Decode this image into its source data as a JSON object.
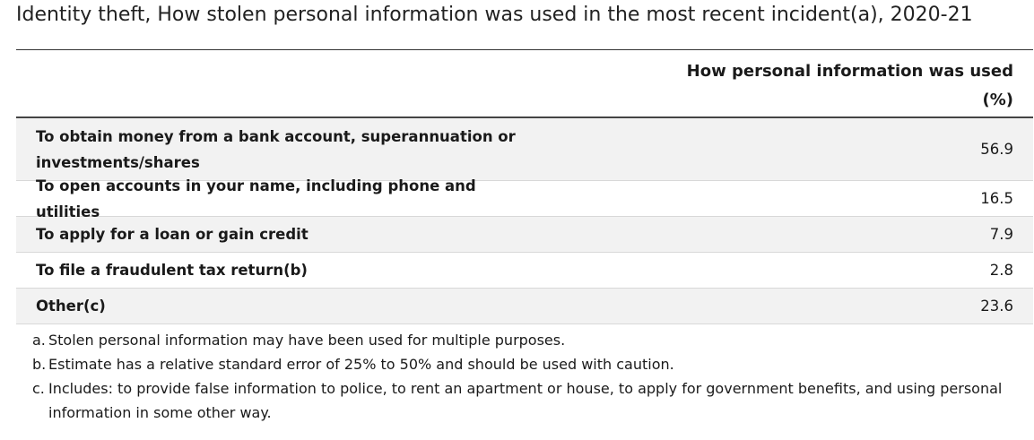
{
  "title": "Identity theft, How stolen personal information was used in the most recent incident(a), 2020-21",
  "table": {
    "column_header_line1": "How personal information was used",
    "column_header_line2": "(%)",
    "rows": [
      {
        "label": "To obtain money from a bank account, superannuation or investments/shares",
        "value": "56.9"
      },
      {
        "label": "To open accounts in your name, including phone and utilities",
        "value": "16.5"
      },
      {
        "label": "To apply for a loan or gain credit",
        "value": "7.9"
      },
      {
        "label": "To file a fraudulent tax return(b)",
        "value": "2.8"
      },
      {
        "label": "Other(c)",
        "value": "23.6"
      }
    ]
  },
  "footnotes": [
    {
      "marker": "a.",
      "text": "Stolen personal information may have been used for multiple purposes."
    },
    {
      "marker": "b.",
      "text": "Estimate has a relative standard error of 25% to 50% and should be used with caution."
    },
    {
      "marker": "c.",
      "text": "Includes: to provide false information to police, to rent an apartment or house, to apply for government benefits, and using personal information in some other way."
    }
  ]
}
